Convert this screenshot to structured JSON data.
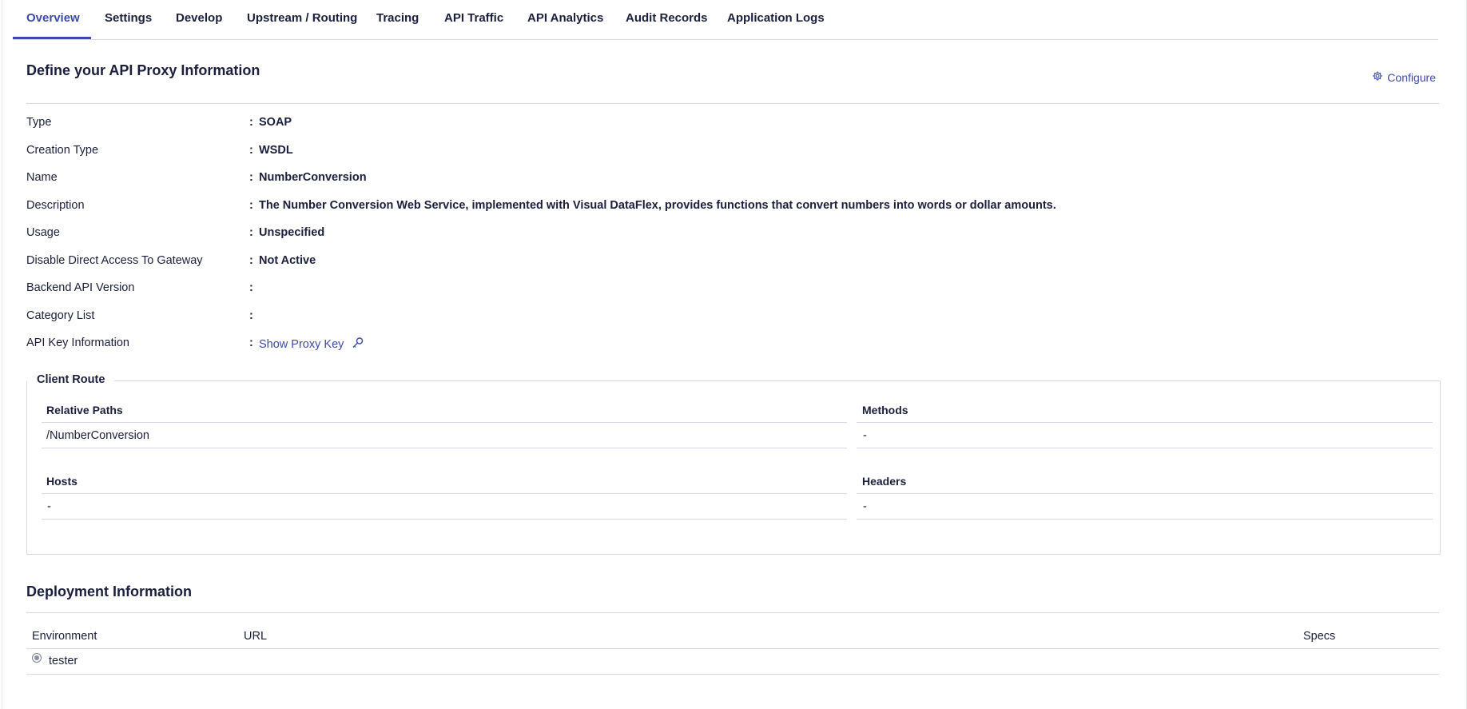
{
  "tabs": [
    {
      "label": "Overview",
      "active": true
    },
    {
      "label": "Settings"
    },
    {
      "label": "Develop"
    },
    {
      "label": "Upstream / Routing"
    },
    {
      "label": "Tracing"
    },
    {
      "label": "API Traffic"
    },
    {
      "label": "API Analytics"
    },
    {
      "label": "Audit Records"
    },
    {
      "label": "Application Logs"
    }
  ],
  "header": {
    "title": "Define your API Proxy Information",
    "configure_label": "Configure",
    "configure_icon": "gear-icon"
  },
  "info": {
    "type": {
      "label": "Type",
      "value": "SOAP"
    },
    "creation_type": {
      "label": "Creation Type",
      "value": "WSDL"
    },
    "name": {
      "label": "Name",
      "value": "NumberConversion"
    },
    "description": {
      "label": "Description",
      "value": "The Number Conversion Web Service, implemented with Visual DataFlex, provides functions that convert numbers into words or dollar amounts."
    },
    "usage": {
      "label": "Usage",
      "value": "Unspecified"
    },
    "disable_direct": {
      "label": "Disable Direct Access To Gateway",
      "value": "Not Active"
    },
    "backend_version": {
      "label": "Backend API Version",
      "value": ""
    },
    "category_list": {
      "label": "Category List",
      "value": ""
    },
    "api_key": {
      "label": "API Key Information",
      "link": "Show Proxy Key",
      "icon": "key-icon"
    },
    "colon": ":"
  },
  "client_route": {
    "legend": "Client Route",
    "relative_paths": {
      "label": "Relative Paths",
      "value": "/NumberConversion"
    },
    "methods": {
      "label": "Methods",
      "value": "-"
    },
    "hosts": {
      "label": "Hosts",
      "value": "-"
    },
    "headers": {
      "label": "Headers",
      "value": "-"
    }
  },
  "deployment": {
    "title": "Deployment Information",
    "columns": {
      "environment": "Environment",
      "url": "URL",
      "specs": "Specs"
    },
    "rows": [
      {
        "environment": "tester",
        "url": "",
        "specs": ""
      }
    ]
  },
  "colors": {
    "accent": "#3c4aa8",
    "text": "#1b1f3b",
    "border": "#d6d9e2"
  }
}
